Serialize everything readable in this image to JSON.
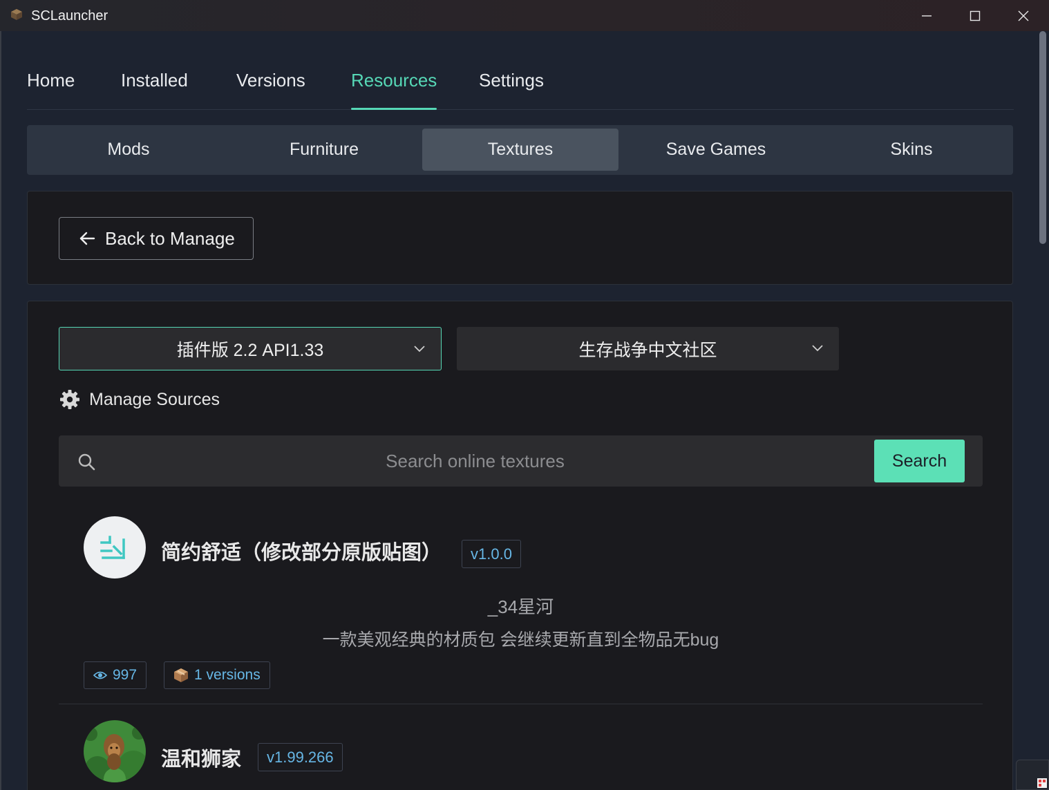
{
  "window": {
    "title": "SCLauncher",
    "controls": [
      "minimize",
      "maximize",
      "close"
    ]
  },
  "nav": {
    "items": [
      {
        "label": "Home",
        "active": false
      },
      {
        "label": "Installed",
        "active": false
      },
      {
        "label": "Versions",
        "active": false
      },
      {
        "label": "Resources",
        "active": true
      },
      {
        "label": "Settings",
        "active": false
      }
    ]
  },
  "subtabs": {
    "items": [
      {
        "label": "Mods",
        "active": false
      },
      {
        "label": "Furniture",
        "active": false
      },
      {
        "label": "Textures",
        "active": true
      },
      {
        "label": "Save Games",
        "active": false
      },
      {
        "label": "Skins",
        "active": false
      }
    ]
  },
  "back_button": {
    "label": "Back to Manage",
    "icon": "arrow-left-icon"
  },
  "filters": {
    "version_select": "插件版 2.2 API1.33",
    "source_select": "生存战争中文社区"
  },
  "manage_sources": {
    "label": "Manage Sources",
    "icon": "gear-icon"
  },
  "search": {
    "value": "",
    "placeholder": "Search online textures",
    "button_label": "Search"
  },
  "results": [
    {
      "title": "简约舒适（修改部分原版贴图）",
      "version": "v1.0.0",
      "author": "_34星河",
      "description": "一款美观经典的材质包 会继续更新直到全物品无bug",
      "views": "997",
      "versions": "1 versions"
    },
    {
      "title": "温和狮家",
      "version": "v1.99.266"
    }
  ],
  "colors": {
    "accent": "#56d8b6",
    "search_button": "#5ce0b6",
    "badge_text": "#67b7e6",
    "background": "#1d2330",
    "panel": "#1a1a1e"
  }
}
